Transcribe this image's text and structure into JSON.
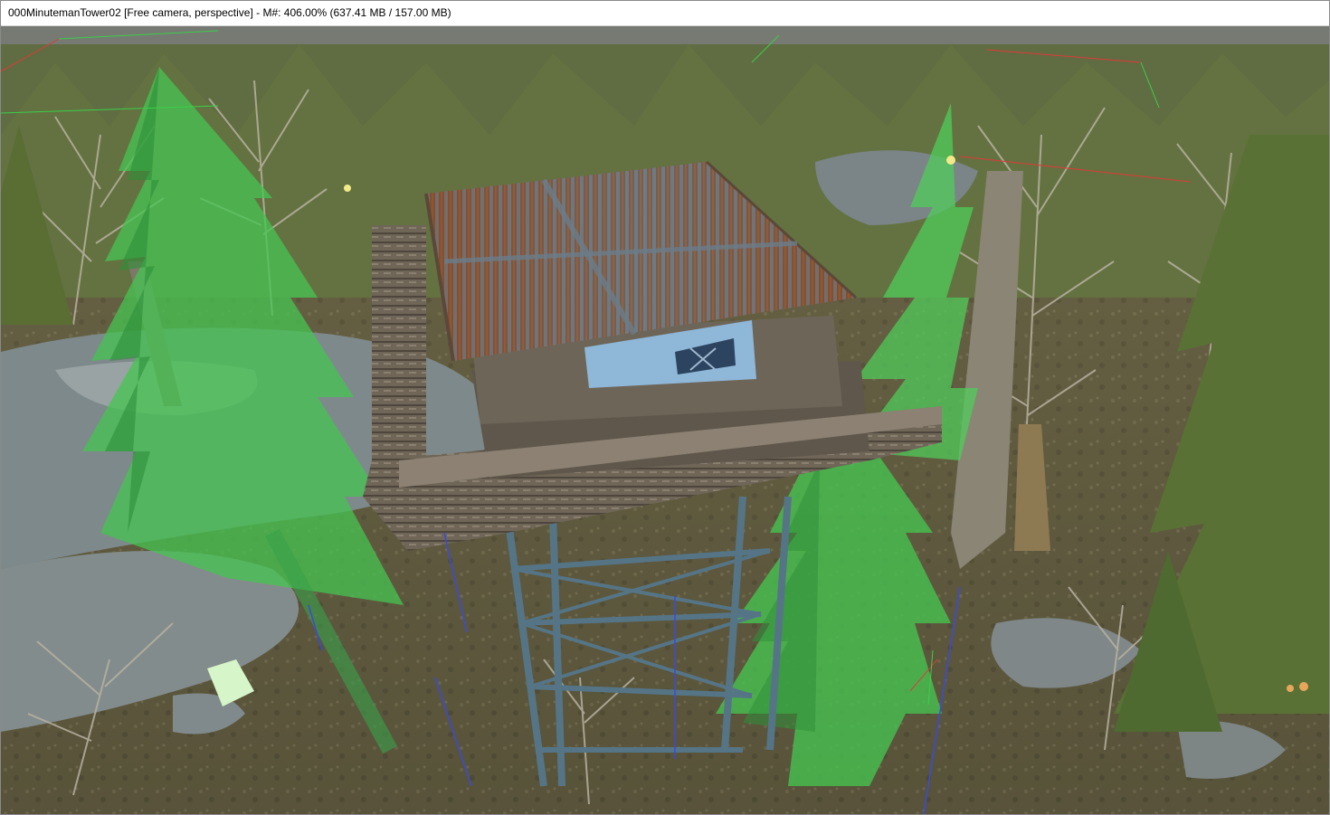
{
  "window": {
    "title": "000MinutemanTower02 [Free camera, perspective] - M#: 406.00% (637.41 MB / 157.00 MB)"
  },
  "viewport": {
    "scene_name": "000MinutemanTower02",
    "camera_mode": "Free camera, perspective",
    "memory_percent": "406.00%",
    "memory_used": "637.41 MB",
    "memory_budget": "157.00 MB"
  },
  "colors": {
    "sky": "#6e7470",
    "forest_floor": "#5e5838",
    "rock": "#7f8a8c",
    "roof_rust": "#8a4a2a",
    "roof_steel": "#6c7f8e",
    "wood": "#6e6355",
    "selection_green": "#4fd35a",
    "tower_frame": "#4f6f80",
    "axis_red": "#e03a3a",
    "axis_green": "#3ad04a",
    "axis_blue": "#3a4ae0"
  },
  "icons": {
    "axis_gizmo": "axis-gizmo-icon"
  }
}
